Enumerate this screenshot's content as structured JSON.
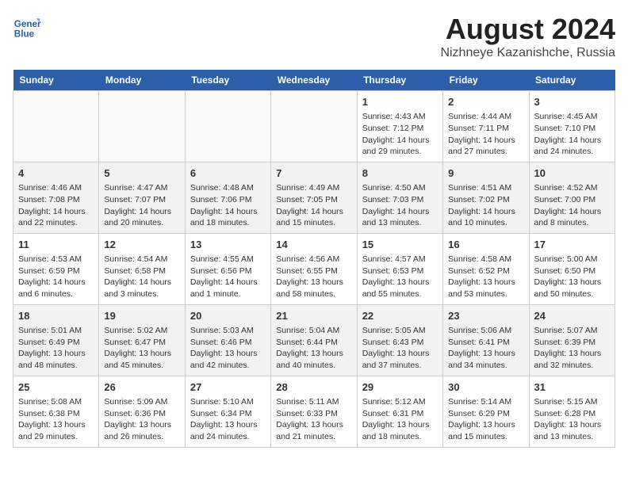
{
  "header": {
    "logo_line1": "General",
    "logo_line2": "Blue",
    "title": "August 2024",
    "subtitle": "Nizhneye Kazanishche, Russia"
  },
  "days_of_week": [
    "Sunday",
    "Monday",
    "Tuesday",
    "Wednesday",
    "Thursday",
    "Friday",
    "Saturday"
  ],
  "weeks": [
    [
      {
        "day": "",
        "info": ""
      },
      {
        "day": "",
        "info": ""
      },
      {
        "day": "",
        "info": ""
      },
      {
        "day": "",
        "info": ""
      },
      {
        "day": "1",
        "info": "Sunrise: 4:43 AM\nSunset: 7:12 PM\nDaylight: 14 hours\nand 29 minutes."
      },
      {
        "day": "2",
        "info": "Sunrise: 4:44 AM\nSunset: 7:11 PM\nDaylight: 14 hours\nand 27 minutes."
      },
      {
        "day": "3",
        "info": "Sunrise: 4:45 AM\nSunset: 7:10 PM\nDaylight: 14 hours\nand 24 minutes."
      }
    ],
    [
      {
        "day": "4",
        "info": "Sunrise: 4:46 AM\nSunset: 7:08 PM\nDaylight: 14 hours\nand 22 minutes."
      },
      {
        "day": "5",
        "info": "Sunrise: 4:47 AM\nSunset: 7:07 PM\nDaylight: 14 hours\nand 20 minutes."
      },
      {
        "day": "6",
        "info": "Sunrise: 4:48 AM\nSunset: 7:06 PM\nDaylight: 14 hours\nand 18 minutes."
      },
      {
        "day": "7",
        "info": "Sunrise: 4:49 AM\nSunset: 7:05 PM\nDaylight: 14 hours\nand 15 minutes."
      },
      {
        "day": "8",
        "info": "Sunrise: 4:50 AM\nSunset: 7:03 PM\nDaylight: 14 hours\nand 13 minutes."
      },
      {
        "day": "9",
        "info": "Sunrise: 4:51 AM\nSunset: 7:02 PM\nDaylight: 14 hours\nand 10 minutes."
      },
      {
        "day": "10",
        "info": "Sunrise: 4:52 AM\nSunset: 7:00 PM\nDaylight: 14 hours\nand 8 minutes."
      }
    ],
    [
      {
        "day": "11",
        "info": "Sunrise: 4:53 AM\nSunset: 6:59 PM\nDaylight: 14 hours\nand 6 minutes."
      },
      {
        "day": "12",
        "info": "Sunrise: 4:54 AM\nSunset: 6:58 PM\nDaylight: 14 hours\nand 3 minutes."
      },
      {
        "day": "13",
        "info": "Sunrise: 4:55 AM\nSunset: 6:56 PM\nDaylight: 14 hours\nand 1 minute."
      },
      {
        "day": "14",
        "info": "Sunrise: 4:56 AM\nSunset: 6:55 PM\nDaylight: 13 hours\nand 58 minutes."
      },
      {
        "day": "15",
        "info": "Sunrise: 4:57 AM\nSunset: 6:53 PM\nDaylight: 13 hours\nand 55 minutes."
      },
      {
        "day": "16",
        "info": "Sunrise: 4:58 AM\nSunset: 6:52 PM\nDaylight: 13 hours\nand 53 minutes."
      },
      {
        "day": "17",
        "info": "Sunrise: 5:00 AM\nSunset: 6:50 PM\nDaylight: 13 hours\nand 50 minutes."
      }
    ],
    [
      {
        "day": "18",
        "info": "Sunrise: 5:01 AM\nSunset: 6:49 PM\nDaylight: 13 hours\nand 48 minutes."
      },
      {
        "day": "19",
        "info": "Sunrise: 5:02 AM\nSunset: 6:47 PM\nDaylight: 13 hours\nand 45 minutes."
      },
      {
        "day": "20",
        "info": "Sunrise: 5:03 AM\nSunset: 6:46 PM\nDaylight: 13 hours\nand 42 minutes."
      },
      {
        "day": "21",
        "info": "Sunrise: 5:04 AM\nSunset: 6:44 PM\nDaylight: 13 hours\nand 40 minutes."
      },
      {
        "day": "22",
        "info": "Sunrise: 5:05 AM\nSunset: 6:43 PM\nDaylight: 13 hours\nand 37 minutes."
      },
      {
        "day": "23",
        "info": "Sunrise: 5:06 AM\nSunset: 6:41 PM\nDaylight: 13 hours\nand 34 minutes."
      },
      {
        "day": "24",
        "info": "Sunrise: 5:07 AM\nSunset: 6:39 PM\nDaylight: 13 hours\nand 32 minutes."
      }
    ],
    [
      {
        "day": "25",
        "info": "Sunrise: 5:08 AM\nSunset: 6:38 PM\nDaylight: 13 hours\nand 29 minutes."
      },
      {
        "day": "26",
        "info": "Sunrise: 5:09 AM\nSunset: 6:36 PM\nDaylight: 13 hours\nand 26 minutes."
      },
      {
        "day": "27",
        "info": "Sunrise: 5:10 AM\nSunset: 6:34 PM\nDaylight: 13 hours\nand 24 minutes."
      },
      {
        "day": "28",
        "info": "Sunrise: 5:11 AM\nSunset: 6:33 PM\nDaylight: 13 hours\nand 21 minutes."
      },
      {
        "day": "29",
        "info": "Sunrise: 5:12 AM\nSunset: 6:31 PM\nDaylight: 13 hours\nand 18 minutes."
      },
      {
        "day": "30",
        "info": "Sunrise: 5:14 AM\nSunset: 6:29 PM\nDaylight: 13 hours\nand 15 minutes."
      },
      {
        "day": "31",
        "info": "Sunrise: 5:15 AM\nSunset: 6:28 PM\nDaylight: 13 hours\nand 13 minutes."
      }
    ]
  ]
}
